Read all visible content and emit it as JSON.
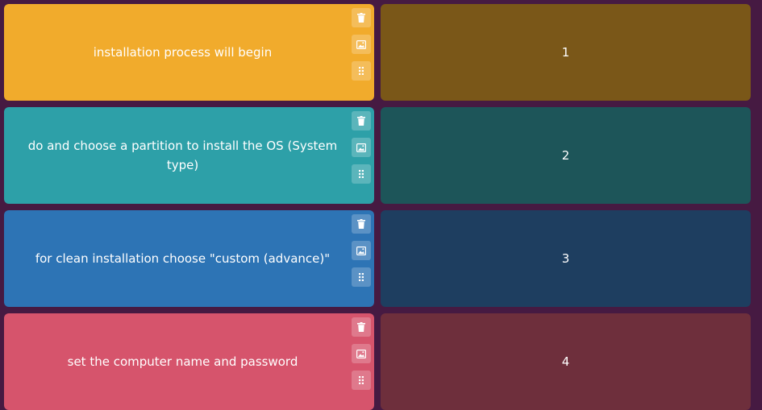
{
  "cards": [
    {
      "text": "installation process will begin",
      "number": "1",
      "color": "#f1ab2c",
      "match_color": "#7a5718"
    },
    {
      "text": "do and choose a partition to install the OS (System type)",
      "number": "2",
      "color": "#2da0a8",
      "match_color": "#1d5559"
    },
    {
      "text": "for clean installation choose \"custom (advance)\"",
      "number": "3",
      "color": "#2d74b5",
      "match_color": "#1e3e60"
    },
    {
      "text": "set the computer name and password",
      "number": "4",
      "color": "#d6546c",
      "match_color": "#6e2f3c"
    }
  ],
  "tool_icons": [
    "trash-icon",
    "image-icon",
    "drag-handle-icon"
  ]
}
